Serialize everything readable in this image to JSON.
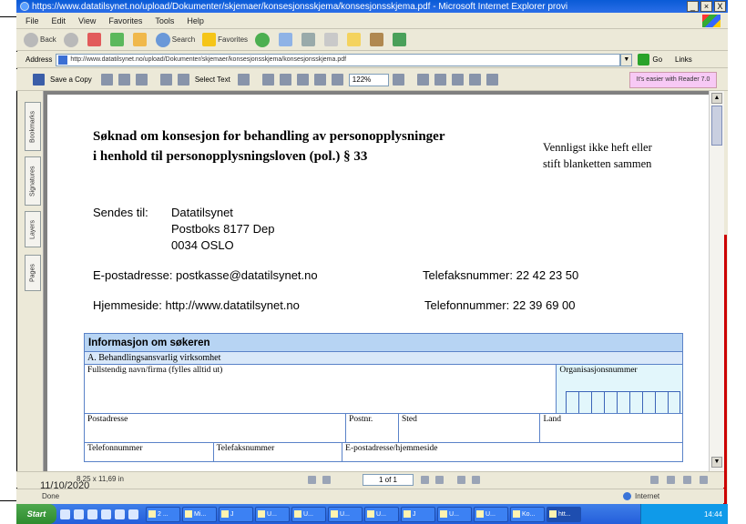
{
  "window": {
    "title": "https://www.datatilsynet.no/upload/Dokumenter/skjemaer/konsesjonsskjema/konsesjonsskjema.pdf - Microsoft Internet Explorer provi",
    "controls": [
      "_",
      "×",
      "X"
    ]
  },
  "menu": [
    "File",
    "Edit",
    "View",
    "Favorites",
    "Tools",
    "Help"
  ],
  "toolbar": {
    "back": "Back",
    "search": "Search",
    "favorites": "Favorites"
  },
  "address": {
    "label": "Address",
    "url": "http://www.datatilsynet.no/upload/Dokumenter/skjemaer/konsesjonsskjema/konsesjonsskjema.pdf",
    "go": "Go",
    "links": "Links"
  },
  "reader": {
    "save_copy": "Save a Copy",
    "select_text": "Select Text",
    "zoom": "122%",
    "promo": "It's easier with Reader 7.0"
  },
  "side_tabs": [
    "Bookmarks",
    "Signatures",
    "Layers",
    "Pages"
  ],
  "document": {
    "heading_line1": "Søknad om konsesjon for behandling av personopplysninger",
    "heading_line2": "i henhold til personopplysningsloven (pol.) § 33",
    "note_line1": "Vennligst ikke heft eller",
    "note_line2": "stift blanketten sammen",
    "send_label": "Sendes til:",
    "addr1": "Datatilsynet",
    "addr2": "Postboks 8177 Dep",
    "addr3": "0034 OSLO",
    "email": "E-postadresse: postkasse@datatilsynet.no",
    "fax": "Telefaksnummer: 22 42 23 50",
    "web": "Hjemmeside: http://www.datatilsynet.no",
    "phone": "Telefonnummer: 22 39 69 00",
    "form": {
      "header": "Informasjon om søkeren",
      "section": "A. Behandlingsansvarlig virksomhet",
      "full_name": "Fullstendig navn/firma (fylles alltid ut)",
      "org_no": "Organisasjonsnummer",
      "post_address": "Postadresse",
      "post_no": "Postnr.",
      "place": "Sted",
      "country": "Land",
      "phone": "Telefonnummer",
      "fax": "Telefaksnummer",
      "email_web": "E-postadresse/hjemmeside"
    }
  },
  "reader_nav": {
    "size": "8,25 x 11,69 in",
    "page": "1 of 1"
  },
  "status": {
    "text": "Done",
    "zone": "Internet",
    "date_overlay": "11/10/2020"
  },
  "taskbar": {
    "start": "Start",
    "tasks": [
      "2 ...",
      "Mi...",
      "J",
      "U...",
      "U...",
      "U...",
      "U...",
      "J",
      "U...",
      "U...",
      "Ko...",
      "htt..."
    ],
    "clock": "14:44"
  }
}
